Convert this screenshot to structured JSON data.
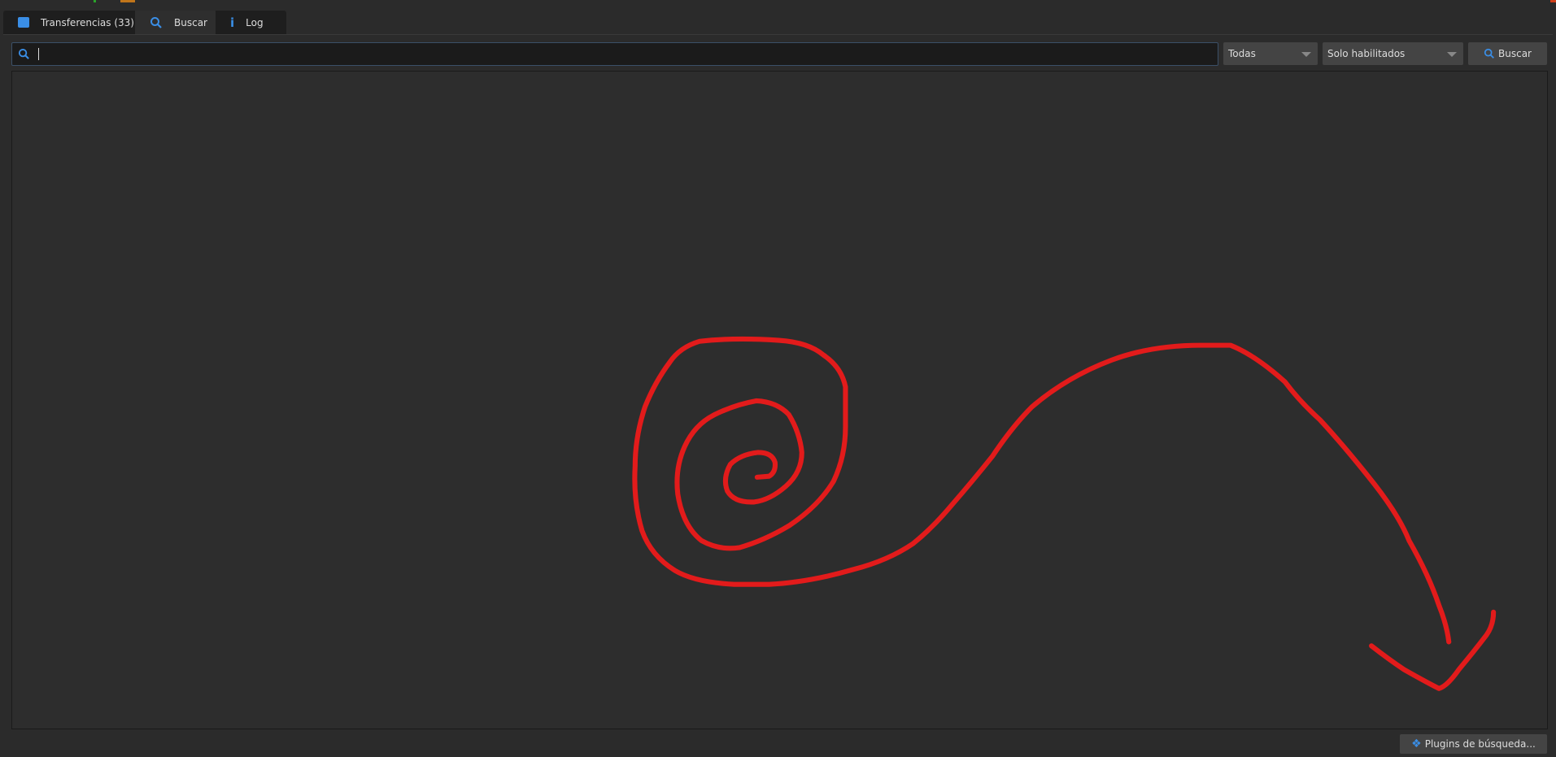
{
  "tabs": [
    {
      "label": "Transferencias (33)",
      "icon": "transfers-folder-icon"
    },
    {
      "label": "Buscar",
      "icon": "search-icon",
      "active": true
    },
    {
      "label": "Log",
      "icon": "info-icon"
    }
  ],
  "search": {
    "value": "",
    "placeholder": ""
  },
  "category_select": {
    "value": "Todas"
  },
  "plugins_select": {
    "value": "Solo habilitados"
  },
  "search_button": {
    "label": "Buscar"
  },
  "plugins_button": {
    "label": "Plugins de búsqueda..."
  },
  "colors": {
    "accent": "#3a8ee6",
    "annotation": "#e21b1b"
  }
}
